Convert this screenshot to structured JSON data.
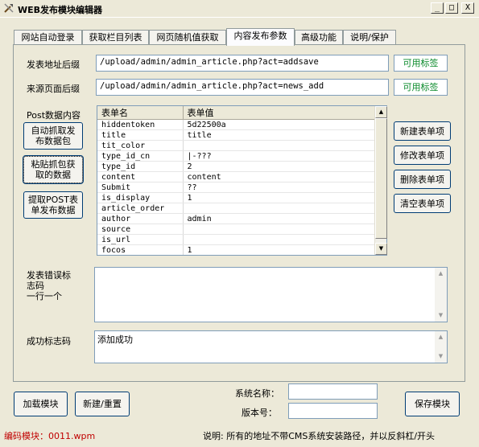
{
  "window": {
    "title": "WEB发布模块编辑器",
    "min_glyph": "_",
    "max_glyph": "□",
    "close_glyph": "X"
  },
  "tabs": [
    {
      "label": "网站自动登录"
    },
    {
      "label": "获取栏目列表"
    },
    {
      "label": "网页随机值获取"
    },
    {
      "label": "内容发布参数"
    },
    {
      "label": "高级功能"
    },
    {
      "label": "说明/保护"
    }
  ],
  "form": {
    "post_url_label": "发表地址后缀",
    "post_url_value": "/upload/admin/admin_article.php?act=addsave",
    "referer_label": "来源页面后缀",
    "referer_value": "/upload/admin/admin_article.php?act=news_add",
    "available_tags": "可用标签",
    "post_data_label": "Post数据内容",
    "error_code_label": "发表错误标\n志码\n一行一个",
    "success_code_label": "成功标志码",
    "success_code_value": "添加成功"
  },
  "left_buttons": {
    "auto_capture": "自动抓取发\n布数据包",
    "paste_capture": "粘贴抓包获\n取的数据",
    "extract_post": "提取POST表\n单发布数据"
  },
  "right_buttons": {
    "new_item": "新建表单项",
    "edit_item": "修改表单项",
    "delete_item": "删除表单项",
    "clear_items": "清空表单项"
  },
  "table": {
    "columns": [
      "表单名",
      "表单值"
    ],
    "rows": [
      [
        "hiddentoken",
        "5d22500a"
      ],
      [
        "title",
        "title"
      ],
      [
        "tit_color",
        ""
      ],
      [
        "type_id_cn",
        "|-???"
      ],
      [
        "type_id",
        "2"
      ],
      [
        "content",
        "content"
      ],
      [
        "Submit",
        "??"
      ],
      [
        "is_display",
        "1"
      ],
      [
        "article_order",
        ""
      ],
      [
        "author",
        "admin"
      ],
      [
        "source",
        ""
      ],
      [
        "is_url",
        ""
      ],
      [
        "focos",
        "1"
      ]
    ]
  },
  "bottom": {
    "load_module": "加载模块",
    "new_reset": "新建/重置",
    "system_name_label": "系统名称：",
    "version_label": "版本号：",
    "system_name_value": "",
    "version_value": "",
    "save_module": "保存模块"
  },
  "status": {
    "module_code": "编码模块：0011.wpm",
    "note": "说明:  所有的地址不带CMS系统安装路径，并以反斜杠/开头"
  }
}
